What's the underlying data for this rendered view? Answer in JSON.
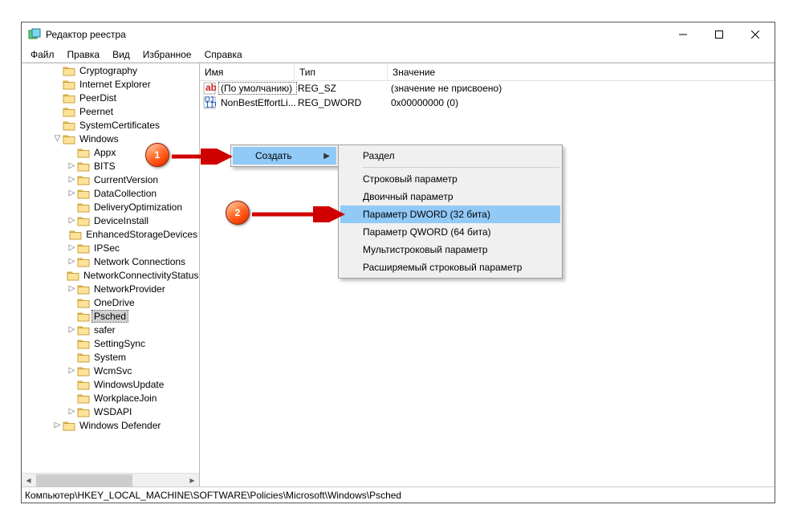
{
  "window": {
    "title": "Редактор реестра"
  },
  "menu": {
    "file": "Файл",
    "edit": "Правка",
    "view": "Вид",
    "favorites": "Избранное",
    "help": "Справка"
  },
  "tree": {
    "items": [
      {
        "indent": 3,
        "tw": "",
        "label": "Cryptography"
      },
      {
        "indent": 3,
        "tw": "",
        "label": "Internet Explorer"
      },
      {
        "indent": 3,
        "tw": "",
        "label": "PeerDist"
      },
      {
        "indent": 3,
        "tw": "",
        "label": "Peernet"
      },
      {
        "indent": 3,
        "tw": "",
        "label": "SystemCertificates"
      },
      {
        "indent": 3,
        "tw": "v",
        "label": "Windows"
      },
      {
        "indent": 4,
        "tw": "",
        "label": "Appx"
      },
      {
        "indent": 4,
        "tw": ">",
        "label": "BITS"
      },
      {
        "indent": 4,
        "tw": ">",
        "label": "CurrentVersion"
      },
      {
        "indent": 4,
        "tw": ">",
        "label": "DataCollection"
      },
      {
        "indent": 4,
        "tw": "",
        "label": "DeliveryOptimization"
      },
      {
        "indent": 4,
        "tw": ">",
        "label": "DeviceInstall"
      },
      {
        "indent": 4,
        "tw": "",
        "label": "EnhancedStorageDevices"
      },
      {
        "indent": 4,
        "tw": ">",
        "label": "IPSec"
      },
      {
        "indent": 4,
        "tw": ">",
        "label": "Network Connections"
      },
      {
        "indent": 4,
        "tw": "",
        "label": "NetworkConnectivityStatus"
      },
      {
        "indent": 4,
        "tw": ">",
        "label": "NetworkProvider"
      },
      {
        "indent": 4,
        "tw": "",
        "label": "OneDrive"
      },
      {
        "indent": 4,
        "tw": "",
        "label": "Psched",
        "sel": true
      },
      {
        "indent": 4,
        "tw": ">",
        "label": "safer"
      },
      {
        "indent": 4,
        "tw": "",
        "label": "SettingSync"
      },
      {
        "indent": 4,
        "tw": "",
        "label": "System"
      },
      {
        "indent": 4,
        "tw": ">",
        "label": "WcmSvc"
      },
      {
        "indent": 4,
        "tw": "",
        "label": "WindowsUpdate"
      },
      {
        "indent": 4,
        "tw": "",
        "label": "WorkplaceJoin"
      },
      {
        "indent": 4,
        "tw": ">",
        "label": "WSDAPI"
      },
      {
        "indent": 3,
        "tw": ">",
        "label": "Windows Defender"
      }
    ]
  },
  "columns": {
    "name": "Имя",
    "type": "Тип",
    "value": "Значение"
  },
  "values": [
    {
      "icon": "sz",
      "name": "(По умолчанию)",
      "default": true,
      "type": "REG_SZ",
      "value": "(значение не присвоено)"
    },
    {
      "icon": "bin",
      "name": "NonBestEffortLi...",
      "type": "REG_DWORD",
      "value": "0x00000000 (0)"
    }
  ],
  "ctx1": {
    "create": "Создать"
  },
  "ctx2": {
    "section": "Раздел",
    "string": "Строковый параметр",
    "binary": "Двоичный параметр",
    "dword": "Параметр DWORD (32 бита)",
    "qword": "Параметр QWORD (64 бита)",
    "multi": "Мультистроковый параметр",
    "expand": "Расширяемый строковый параметр"
  },
  "status": "Компьютер\\HKEY_LOCAL_MACHINE\\SOFTWARE\\Policies\\Microsoft\\Windows\\Psched",
  "anno": {
    "one": "1",
    "two": "2"
  }
}
